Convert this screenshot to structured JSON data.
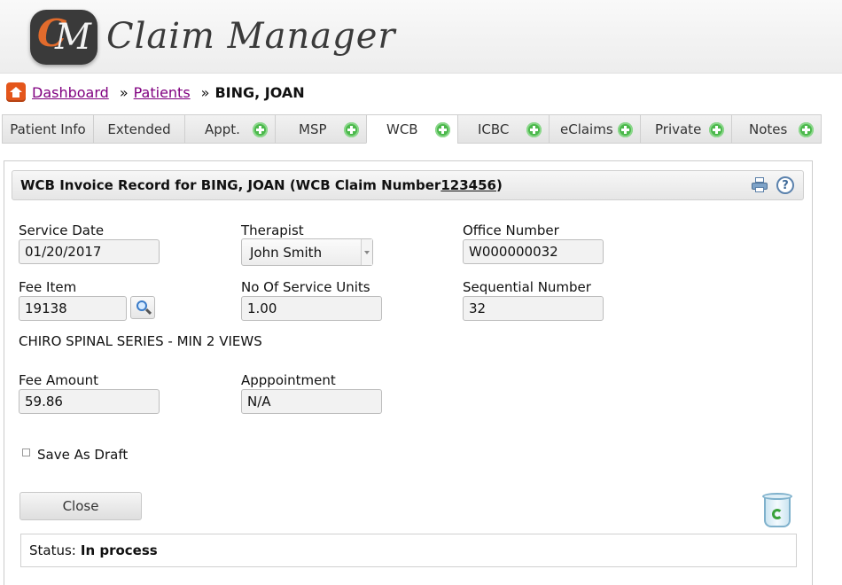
{
  "app": {
    "logo_letters": "CM",
    "logo_text": "Claim Manager"
  },
  "breadcrumb": {
    "home_icon": "home-icon",
    "dashboard": "Dashboard",
    "separator": "»",
    "patients": "Patients",
    "current": "BING, JOAN"
  },
  "tabs": [
    {
      "label": "Patient Info",
      "has_add": false,
      "active": false
    },
    {
      "label": "Extended",
      "has_add": false,
      "active": false
    },
    {
      "label": "Appt.",
      "has_add": true,
      "active": false
    },
    {
      "label": "MSP",
      "has_add": true,
      "active": false
    },
    {
      "label": "WCB",
      "has_add": true,
      "active": true
    },
    {
      "label": "ICBC",
      "has_add": true,
      "active": false
    },
    {
      "label": "eClaims",
      "has_add": true,
      "active": false
    },
    {
      "label": "Private",
      "has_add": true,
      "active": false
    },
    {
      "label": "Notes",
      "has_add": true,
      "active": false
    }
  ],
  "panel": {
    "title_prefix": "WCB Invoice Record for BING, JOAN (WCB Claim Number ",
    "claim_number": "123456",
    "title_suffix": ")",
    "print_icon": "print-icon",
    "help_icon": "help-icon",
    "help_symbol": "?"
  },
  "form": {
    "service_date": {
      "label": "Service Date",
      "value": "01/20/2017"
    },
    "therapist": {
      "label": "Therapist",
      "value": "John Smith"
    },
    "office_number": {
      "label": "Office Number",
      "value": "W000000032"
    },
    "fee_item": {
      "label": "Fee Item",
      "value": "19138"
    },
    "service_units": {
      "label": "No Of Service Units",
      "value": "1.00"
    },
    "sequential_number": {
      "label": "Sequential Number",
      "value": "32"
    },
    "fee_description": "CHIRO SPINAL SERIES - MIN 2 VIEWS",
    "fee_amount": {
      "label": "Fee Amount",
      "value": "59.86"
    },
    "appointment": {
      "label": "Apppointment",
      "value": "N/A"
    },
    "save_as_draft": {
      "label": "Save As Draft",
      "checked": false
    }
  },
  "actions": {
    "close_label": "Close",
    "trash_icon": "recycle-bin-icon"
  },
  "status": {
    "label": "Status:",
    "value": "In process"
  },
  "colors": {
    "accent_orange": "#e4561b",
    "link_visited": "#800080",
    "add_green": "#4cb84c"
  }
}
